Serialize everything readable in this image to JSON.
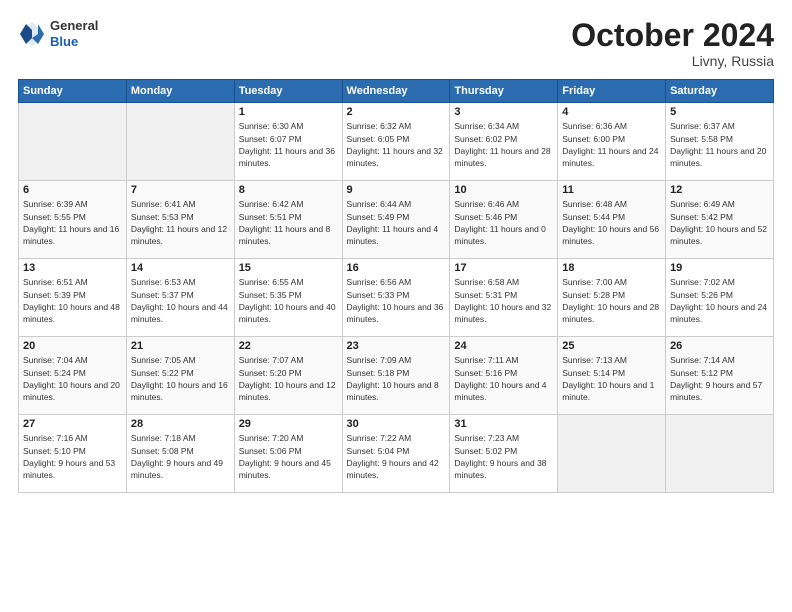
{
  "header": {
    "logo_line1": "General",
    "logo_line2": "Blue",
    "month": "October 2024",
    "location": "Livny, Russia"
  },
  "weekdays": [
    "Sunday",
    "Monday",
    "Tuesday",
    "Wednesday",
    "Thursday",
    "Friday",
    "Saturday"
  ],
  "weeks": [
    [
      {
        "day": "",
        "sunrise": "",
        "sunset": "",
        "daylight": ""
      },
      {
        "day": "",
        "sunrise": "",
        "sunset": "",
        "daylight": ""
      },
      {
        "day": "1",
        "sunrise": "Sunrise: 6:30 AM",
        "sunset": "Sunset: 6:07 PM",
        "daylight": "Daylight: 11 hours and 36 minutes."
      },
      {
        "day": "2",
        "sunrise": "Sunrise: 6:32 AM",
        "sunset": "Sunset: 6:05 PM",
        "daylight": "Daylight: 11 hours and 32 minutes."
      },
      {
        "day": "3",
        "sunrise": "Sunrise: 6:34 AM",
        "sunset": "Sunset: 6:02 PM",
        "daylight": "Daylight: 11 hours and 28 minutes."
      },
      {
        "day": "4",
        "sunrise": "Sunrise: 6:36 AM",
        "sunset": "Sunset: 6:00 PM",
        "daylight": "Daylight: 11 hours and 24 minutes."
      },
      {
        "day": "5",
        "sunrise": "Sunrise: 6:37 AM",
        "sunset": "Sunset: 5:58 PM",
        "daylight": "Daylight: 11 hours and 20 minutes."
      }
    ],
    [
      {
        "day": "6",
        "sunrise": "Sunrise: 6:39 AM",
        "sunset": "Sunset: 5:55 PM",
        "daylight": "Daylight: 11 hours and 16 minutes."
      },
      {
        "day": "7",
        "sunrise": "Sunrise: 6:41 AM",
        "sunset": "Sunset: 5:53 PM",
        "daylight": "Daylight: 11 hours and 12 minutes."
      },
      {
        "day": "8",
        "sunrise": "Sunrise: 6:42 AM",
        "sunset": "Sunset: 5:51 PM",
        "daylight": "Daylight: 11 hours and 8 minutes."
      },
      {
        "day": "9",
        "sunrise": "Sunrise: 6:44 AM",
        "sunset": "Sunset: 5:49 PM",
        "daylight": "Daylight: 11 hours and 4 minutes."
      },
      {
        "day": "10",
        "sunrise": "Sunrise: 6:46 AM",
        "sunset": "Sunset: 5:46 PM",
        "daylight": "Daylight: 11 hours and 0 minutes."
      },
      {
        "day": "11",
        "sunrise": "Sunrise: 6:48 AM",
        "sunset": "Sunset: 5:44 PM",
        "daylight": "Daylight: 10 hours and 56 minutes."
      },
      {
        "day": "12",
        "sunrise": "Sunrise: 6:49 AM",
        "sunset": "Sunset: 5:42 PM",
        "daylight": "Daylight: 10 hours and 52 minutes."
      }
    ],
    [
      {
        "day": "13",
        "sunrise": "Sunrise: 6:51 AM",
        "sunset": "Sunset: 5:39 PM",
        "daylight": "Daylight: 10 hours and 48 minutes."
      },
      {
        "day": "14",
        "sunrise": "Sunrise: 6:53 AM",
        "sunset": "Sunset: 5:37 PM",
        "daylight": "Daylight: 10 hours and 44 minutes."
      },
      {
        "day": "15",
        "sunrise": "Sunrise: 6:55 AM",
        "sunset": "Sunset: 5:35 PM",
        "daylight": "Daylight: 10 hours and 40 minutes."
      },
      {
        "day": "16",
        "sunrise": "Sunrise: 6:56 AM",
        "sunset": "Sunset: 5:33 PM",
        "daylight": "Daylight: 10 hours and 36 minutes."
      },
      {
        "day": "17",
        "sunrise": "Sunrise: 6:58 AM",
        "sunset": "Sunset: 5:31 PM",
        "daylight": "Daylight: 10 hours and 32 minutes."
      },
      {
        "day": "18",
        "sunrise": "Sunrise: 7:00 AM",
        "sunset": "Sunset: 5:28 PM",
        "daylight": "Daylight: 10 hours and 28 minutes."
      },
      {
        "day": "19",
        "sunrise": "Sunrise: 7:02 AM",
        "sunset": "Sunset: 5:26 PM",
        "daylight": "Daylight: 10 hours and 24 minutes."
      }
    ],
    [
      {
        "day": "20",
        "sunrise": "Sunrise: 7:04 AM",
        "sunset": "Sunset: 5:24 PM",
        "daylight": "Daylight: 10 hours and 20 minutes."
      },
      {
        "day": "21",
        "sunrise": "Sunrise: 7:05 AM",
        "sunset": "Sunset: 5:22 PM",
        "daylight": "Daylight: 10 hours and 16 minutes."
      },
      {
        "day": "22",
        "sunrise": "Sunrise: 7:07 AM",
        "sunset": "Sunset: 5:20 PM",
        "daylight": "Daylight: 10 hours and 12 minutes."
      },
      {
        "day": "23",
        "sunrise": "Sunrise: 7:09 AM",
        "sunset": "Sunset: 5:18 PM",
        "daylight": "Daylight: 10 hours and 8 minutes."
      },
      {
        "day": "24",
        "sunrise": "Sunrise: 7:11 AM",
        "sunset": "Sunset: 5:16 PM",
        "daylight": "Daylight: 10 hours and 4 minutes."
      },
      {
        "day": "25",
        "sunrise": "Sunrise: 7:13 AM",
        "sunset": "Sunset: 5:14 PM",
        "daylight": "Daylight: 10 hours and 1 minute."
      },
      {
        "day": "26",
        "sunrise": "Sunrise: 7:14 AM",
        "sunset": "Sunset: 5:12 PM",
        "daylight": "Daylight: 9 hours and 57 minutes."
      }
    ],
    [
      {
        "day": "27",
        "sunrise": "Sunrise: 7:16 AM",
        "sunset": "Sunset: 5:10 PM",
        "daylight": "Daylight: 9 hours and 53 minutes."
      },
      {
        "day": "28",
        "sunrise": "Sunrise: 7:18 AM",
        "sunset": "Sunset: 5:08 PM",
        "daylight": "Daylight: 9 hours and 49 minutes."
      },
      {
        "day": "29",
        "sunrise": "Sunrise: 7:20 AM",
        "sunset": "Sunset: 5:06 PM",
        "daylight": "Daylight: 9 hours and 45 minutes."
      },
      {
        "day": "30",
        "sunrise": "Sunrise: 7:22 AM",
        "sunset": "Sunset: 5:04 PM",
        "daylight": "Daylight: 9 hours and 42 minutes."
      },
      {
        "day": "31",
        "sunrise": "Sunrise: 7:23 AM",
        "sunset": "Sunset: 5:02 PM",
        "daylight": "Daylight: 9 hours and 38 minutes."
      },
      {
        "day": "",
        "sunrise": "",
        "sunset": "",
        "daylight": ""
      },
      {
        "day": "",
        "sunrise": "",
        "sunset": "",
        "daylight": ""
      }
    ]
  ]
}
